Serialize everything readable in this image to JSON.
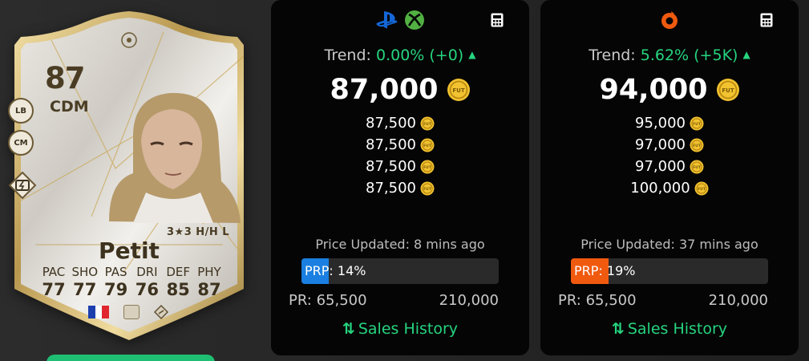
{
  "card": {
    "rating": "87",
    "position": "CDM",
    "alt_positions": [
      "LB",
      "CM"
    ],
    "skills": "3★3 H/H L",
    "name": "Petit",
    "stats": {
      "labels": [
        "PAC",
        "SHO",
        "PAS",
        "DRI",
        "DEF",
        "PHY"
      ],
      "values": [
        "77",
        "77",
        "79",
        "76",
        "85",
        "87"
      ]
    },
    "nation": "france-flag",
    "league": "icons-league-badge",
    "club": "icons-club-badge"
  },
  "panels": [
    {
      "platform_icons": [
        "playstation-icon",
        "xbox-icon"
      ],
      "trend_label": "Trend:",
      "trend_value": "0.00% (+0)",
      "price": "87,000",
      "listings": [
        "87,500",
        "87,500",
        "87,500",
        "87,500"
      ],
      "updated": "Price Updated: 8 mins ago",
      "prp_label": "PRP",
      "prp_value": ": 14%",
      "prp_percent": 14,
      "prp_color": "#1a7fe0",
      "pr_min": "PR: 65,500",
      "pr_max": "210,000",
      "sales_label": "Sales History"
    },
    {
      "platform_icons": [
        "origin-icon"
      ],
      "trend_label": "Trend:",
      "trend_value": "5.62% (+5K)",
      "price": "94,000",
      "listings": [
        "95,000",
        "97,000",
        "97,000",
        "100,000"
      ],
      "updated": "Price Updated: 37 mins ago",
      "prp_label": "PRP",
      "prp_value": ": 19%",
      "prp_percent": 19,
      "prp_color": "#f05a0f",
      "pr_min": "PR: 65,500",
      "pr_max": "210,000",
      "sales_label": "Sales History"
    }
  ],
  "colors": {
    "accent_green": "#26d47f",
    "panel_bg": "#050505",
    "coin_gold": "#f2c230"
  }
}
